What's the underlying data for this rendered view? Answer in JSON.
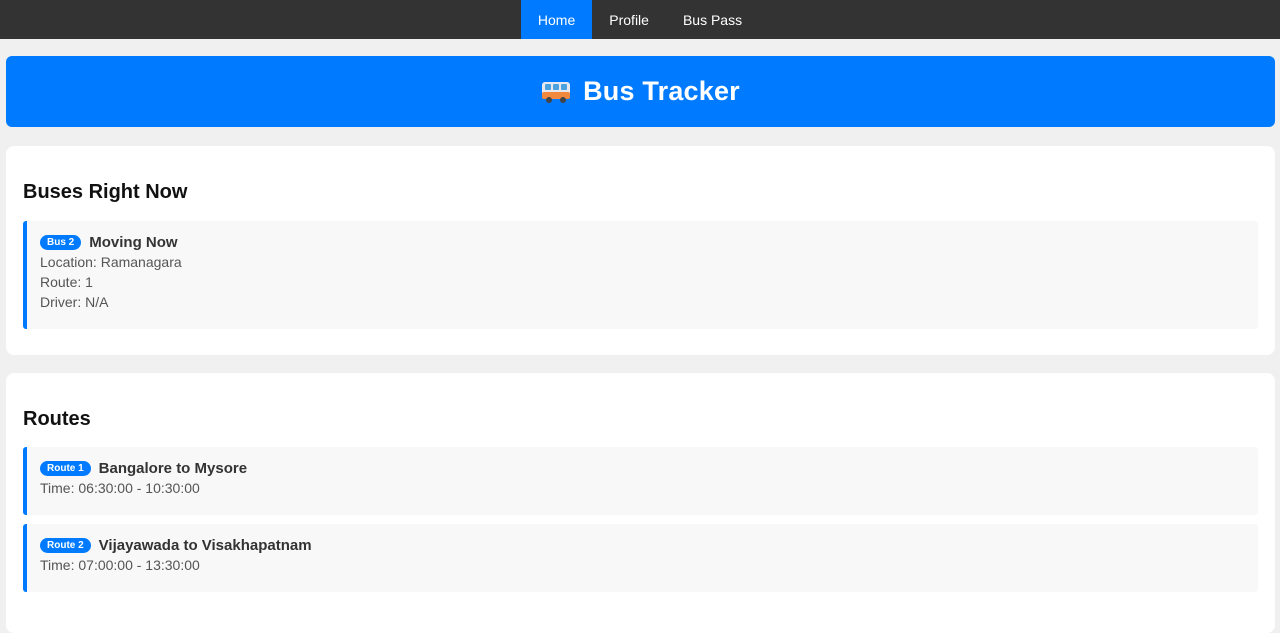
{
  "nav": {
    "items": [
      {
        "label": "Home",
        "active": true
      },
      {
        "label": "Profile",
        "active": false
      },
      {
        "label": "Bus Pass",
        "active": false
      }
    ]
  },
  "header": {
    "icon": "bus-icon",
    "title": "Bus Tracker"
  },
  "buses_section": {
    "heading": "Buses Right Now",
    "buses": [
      {
        "badge": "Bus 2",
        "status": "Moving Now",
        "location": "Location: Ramanagara",
        "route": "Route: 1",
        "driver": "Driver: N/A"
      }
    ]
  },
  "routes_section": {
    "heading": "Routes",
    "routes": [
      {
        "badge": "Route 1",
        "name": "Bangalore to Mysore",
        "time": "Time: 06:30:00 - 10:30:00"
      },
      {
        "badge": "Route 2",
        "name": "Vijayawada to Visakhapatnam",
        "time": "Time: 07:00:00 - 13:30:00"
      }
    ]
  },
  "colors": {
    "accent": "#007bff",
    "nav_bg": "#333333",
    "page_bg": "#f0f0f0"
  }
}
